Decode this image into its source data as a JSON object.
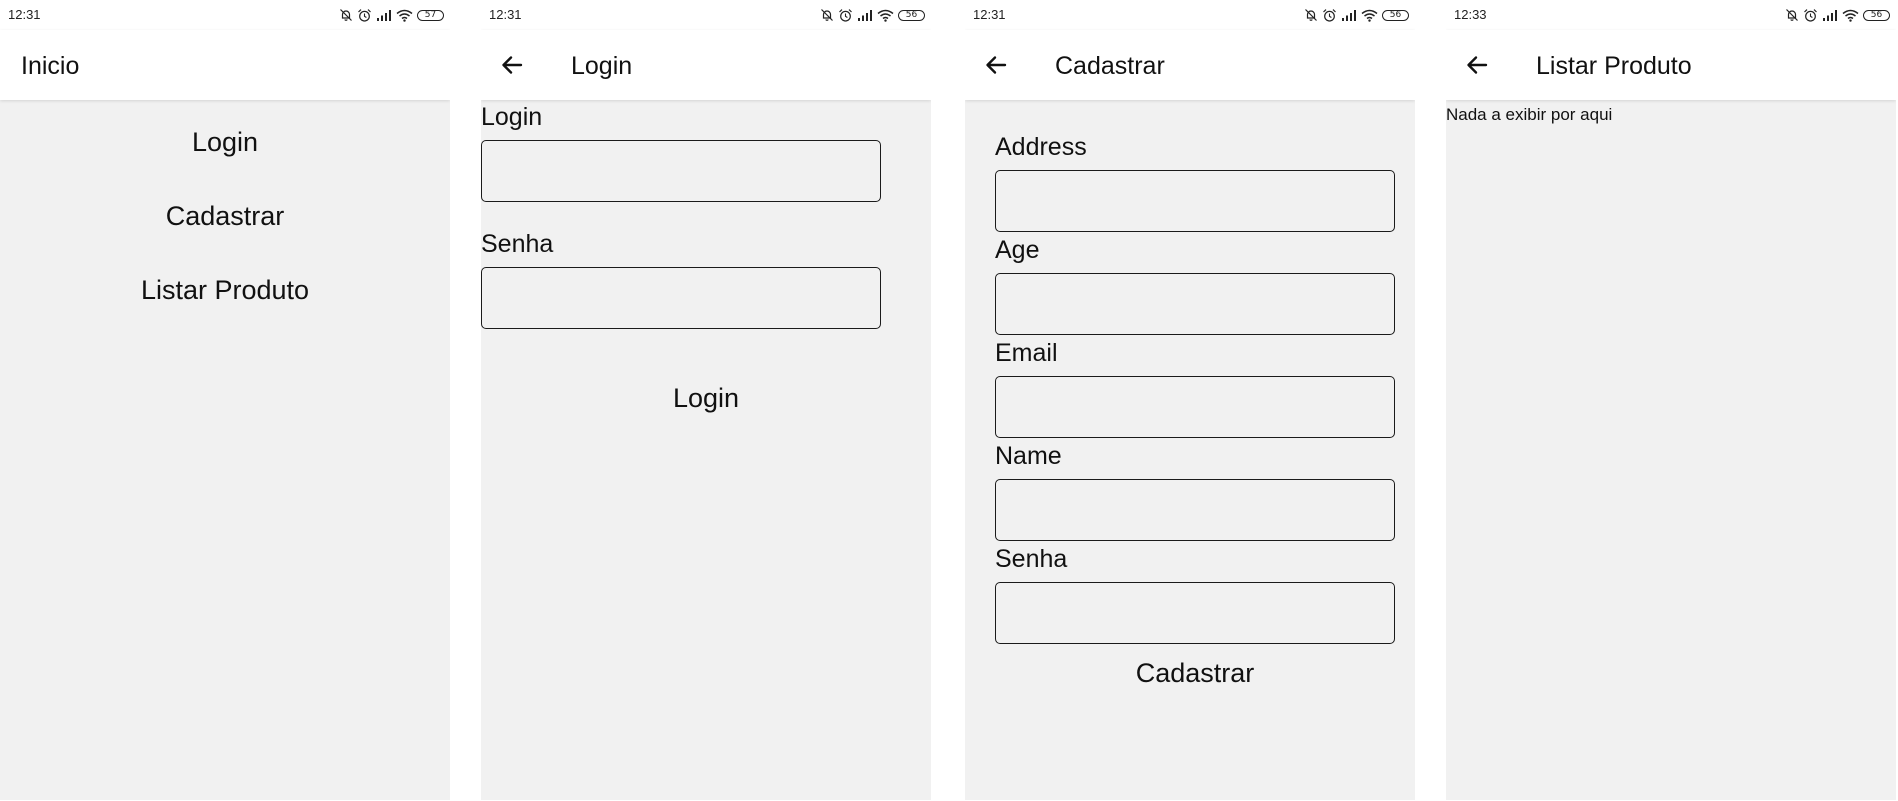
{
  "screens": {
    "inicio": {
      "time": "12:31",
      "battery": "57",
      "title": "Inicio",
      "buttons": [
        "Login",
        "Cadastrar",
        "Listar Produto"
      ]
    },
    "login": {
      "time": "12:31",
      "battery": "56",
      "title": "Login",
      "fields": [
        "Login",
        "Senha"
      ],
      "action": "Login"
    },
    "cadastrar": {
      "time": "12:31",
      "battery": "56",
      "title": "Cadastrar",
      "fields": [
        "Address",
        "Age",
        "Email",
        "Name",
        "Senha"
      ],
      "action": "Cadastrar"
    },
    "listar": {
      "time": "12:33",
      "battery": "56",
      "title": "Listar Produto",
      "empty_message": "Nada a exibir por aqui"
    }
  },
  "status_icons": [
    "bell-off-icon",
    "alarm-icon",
    "signal-icon",
    "wifi-icon",
    "battery-icon"
  ],
  "colors": {
    "background": "#f1f1f1",
    "appbar": "#ffffff",
    "text": "#111111",
    "border": "#1b1b1b"
  }
}
